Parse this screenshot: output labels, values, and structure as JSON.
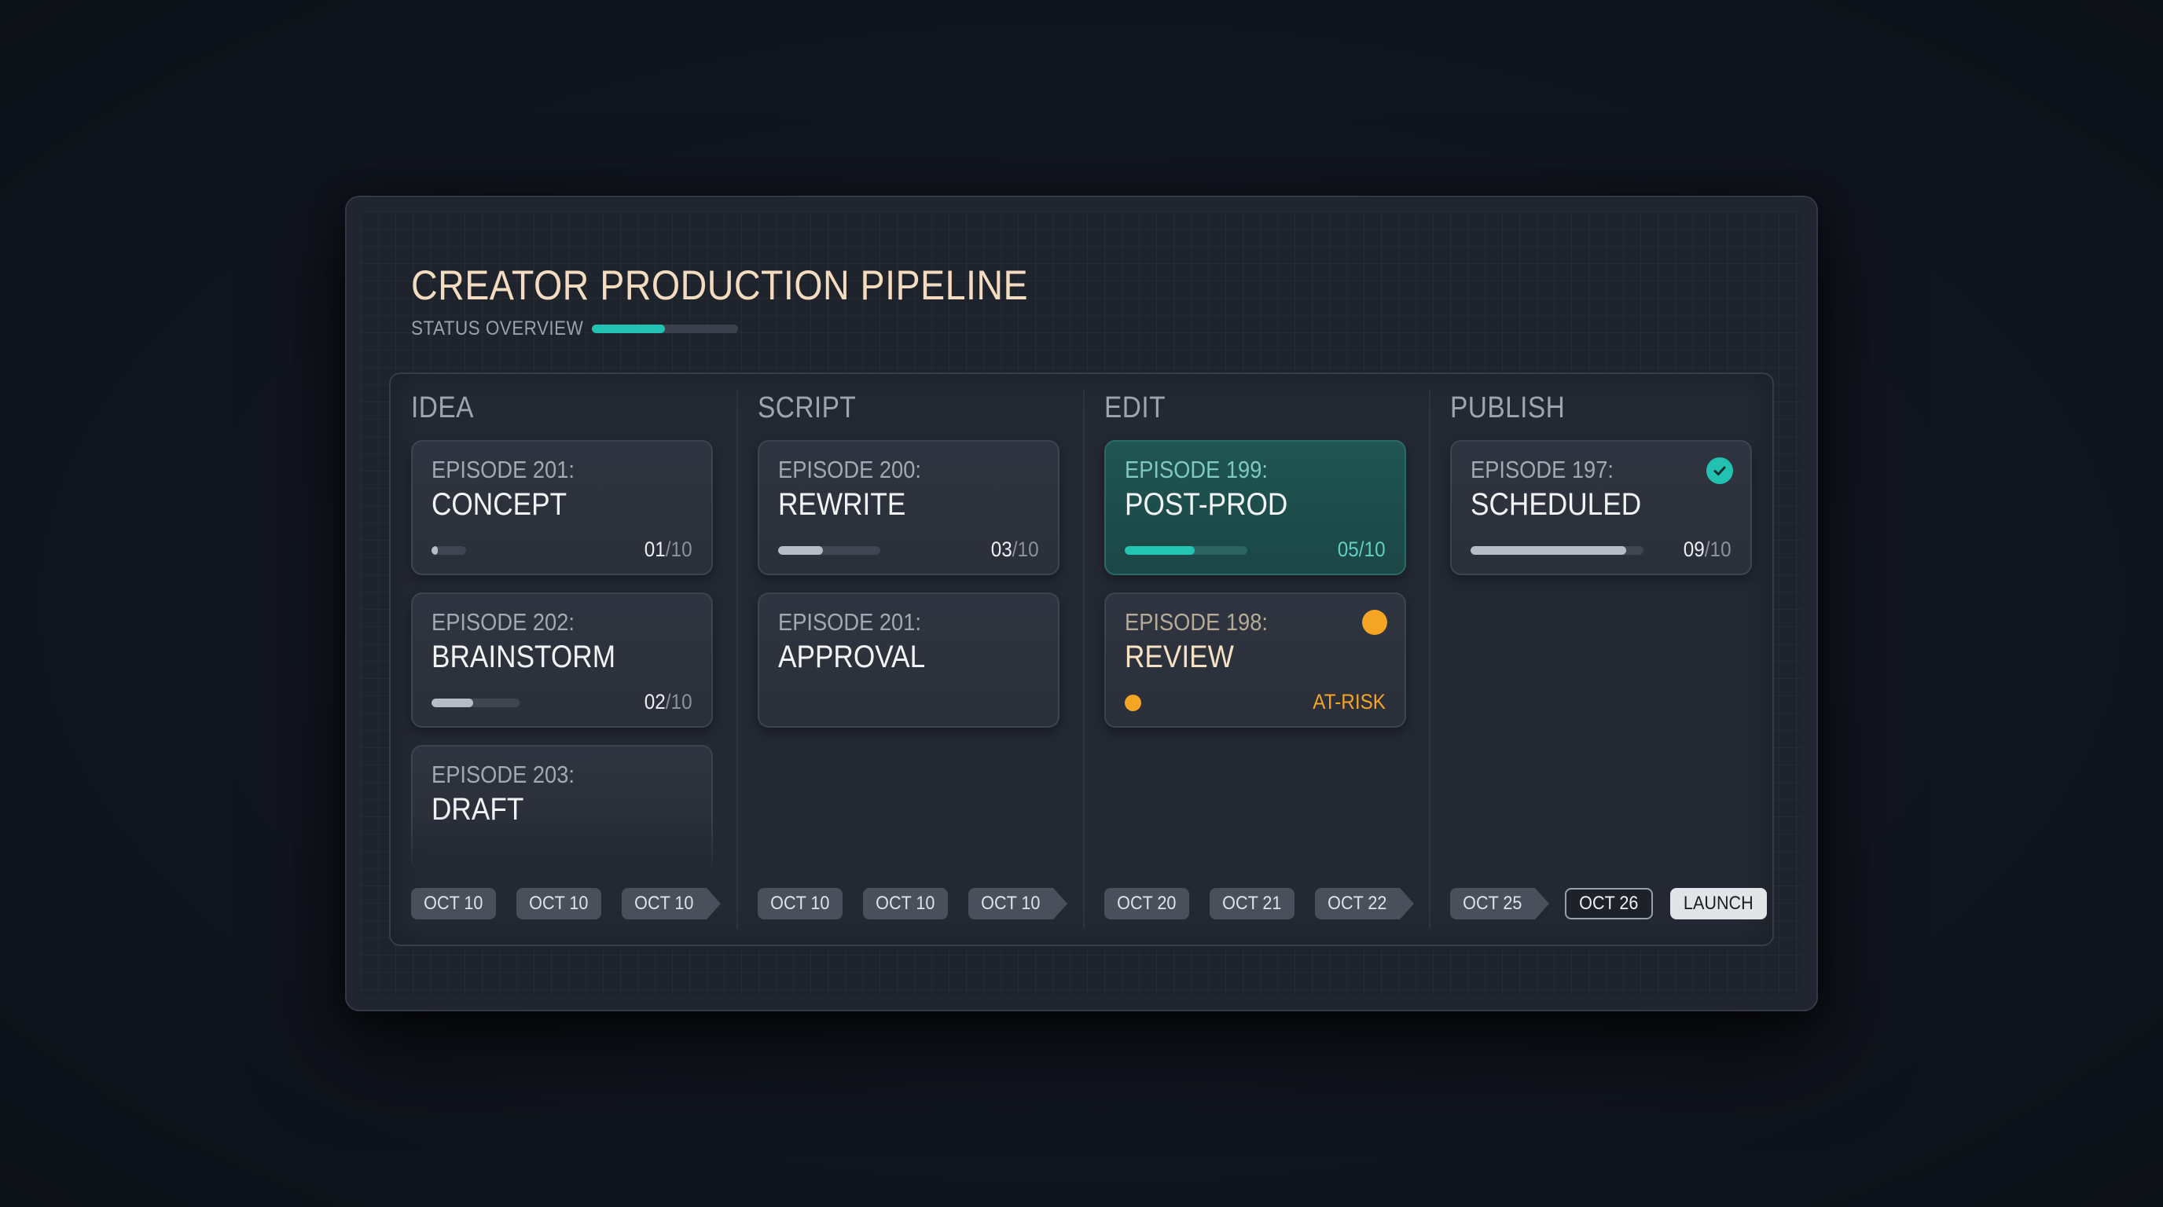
{
  "header": {
    "title": "CREATOR PRODUCTION PIPELINE",
    "subtitle": "STATUS OVERVIEW",
    "overview_progress": 0.5
  },
  "colors": {
    "accent_teal": "#22c1b1",
    "at_risk_amber": "#f5a524"
  },
  "columns": [
    {
      "title": "IDEA",
      "cards": [
        {
          "episode": "EPISODE 201:",
          "name": "CONCEPT",
          "count": "01",
          "total": "/10",
          "progress": 0.1
        },
        {
          "episode": "EPISODE 202:",
          "name": "BRAINSTORM",
          "count": "02",
          "total": "/10",
          "progress": 0.2
        },
        {
          "episode": "EPISODE 203:",
          "name": "DRAFT"
        }
      ],
      "dates": [
        "OCT 10",
        "OCT 10",
        "OCT 10"
      ]
    },
    {
      "title": "SCRIPT",
      "cards": [
        {
          "episode": "EPISODE 200:",
          "name": "REWRITE",
          "count": "03",
          "total": "/10",
          "progress": 0.3
        },
        {
          "episode": "EPISODE 201:",
          "name": "APPROVAL"
        }
      ],
      "dates": [
        "OCT 10",
        "OCT 10",
        "OCT 10"
      ]
    },
    {
      "title": "EDIT",
      "cards": [
        {
          "episode": "EPISODE 199:",
          "name": "POST-PROD",
          "count": "05",
          "total": "/10",
          "progress": 0.5
        },
        {
          "episode": "EPISODE 198:",
          "name": "REVIEW",
          "status": "AT-RISK"
        }
      ],
      "dates": [
        "OCT 20",
        "OCT 21",
        "OCT 22"
      ]
    },
    {
      "title": "PUBLISH",
      "cards": [
        {
          "episode": "EPISODE 197:",
          "name": "SCHEDULED",
          "count": "09",
          "total": "/10",
          "progress": 0.9,
          "icon": "check-circle-icon"
        }
      ],
      "dates": [
        "OCT 25",
        "OCT 26"
      ],
      "launch_label": "LAUNCH"
    }
  ]
}
